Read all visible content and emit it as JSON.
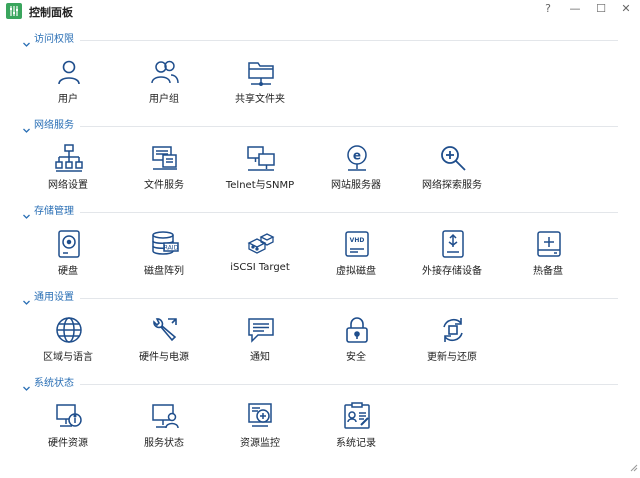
{
  "window": {
    "title": "控制面板",
    "help_glyph": "?",
    "minimize_glyph": "—",
    "maximize_glyph": "☐",
    "close_glyph": "✕"
  },
  "sections": [
    {
      "title": "访问权限",
      "items": [
        {
          "label": "用户",
          "icon": "user-icon"
        },
        {
          "label": "用户组",
          "icon": "user-group-icon"
        },
        {
          "label": "共享文件夹",
          "icon": "shared-folder-icon"
        }
      ]
    },
    {
      "title": "网络服务",
      "items": [
        {
          "label": "网络设置",
          "icon": "network-settings-icon"
        },
        {
          "label": "文件服务",
          "icon": "file-services-icon"
        },
        {
          "label": "Telnet与SNMP",
          "icon": "telnet-snmp-icon"
        },
        {
          "label": "网站服务器",
          "icon": "web-server-icon"
        },
        {
          "label": "网络探索服务",
          "icon": "network-discovery-icon"
        }
      ]
    },
    {
      "title": "存储管理",
      "items": [
        {
          "label": "硬盘",
          "icon": "hard-disk-icon"
        },
        {
          "label": "磁盘阵列",
          "icon": "raid-icon"
        },
        {
          "label": "iSCSI Target",
          "icon": "iscsi-target-icon"
        },
        {
          "label": "虚拟磁盘",
          "icon": "virtual-disk-icon"
        },
        {
          "label": "外接存储设备",
          "icon": "external-storage-icon"
        },
        {
          "label": "热备盘",
          "icon": "hot-spare-icon"
        }
      ]
    },
    {
      "title": "通用设置",
      "items": [
        {
          "label": "区域与语言",
          "icon": "globe-icon"
        },
        {
          "label": "硬件与电源",
          "icon": "wrench-icon"
        },
        {
          "label": "通知",
          "icon": "notification-icon"
        },
        {
          "label": "安全",
          "icon": "lock-icon"
        },
        {
          "label": "更新与还原",
          "icon": "update-icon"
        }
      ]
    },
    {
      "title": "系统状态",
      "items": [
        {
          "label": "硬件资源",
          "icon": "hardware-resources-icon"
        },
        {
          "label": "服务状态",
          "icon": "service-status-icon"
        },
        {
          "label": "资源监控",
          "icon": "resource-monitor-icon"
        },
        {
          "label": "系统记录",
          "icon": "system-log-icon"
        }
      ]
    }
  ],
  "colors": {
    "icon": "#1f4e8c",
    "section_title": "#2a6fb5",
    "app_icon": "#3aa55d"
  }
}
